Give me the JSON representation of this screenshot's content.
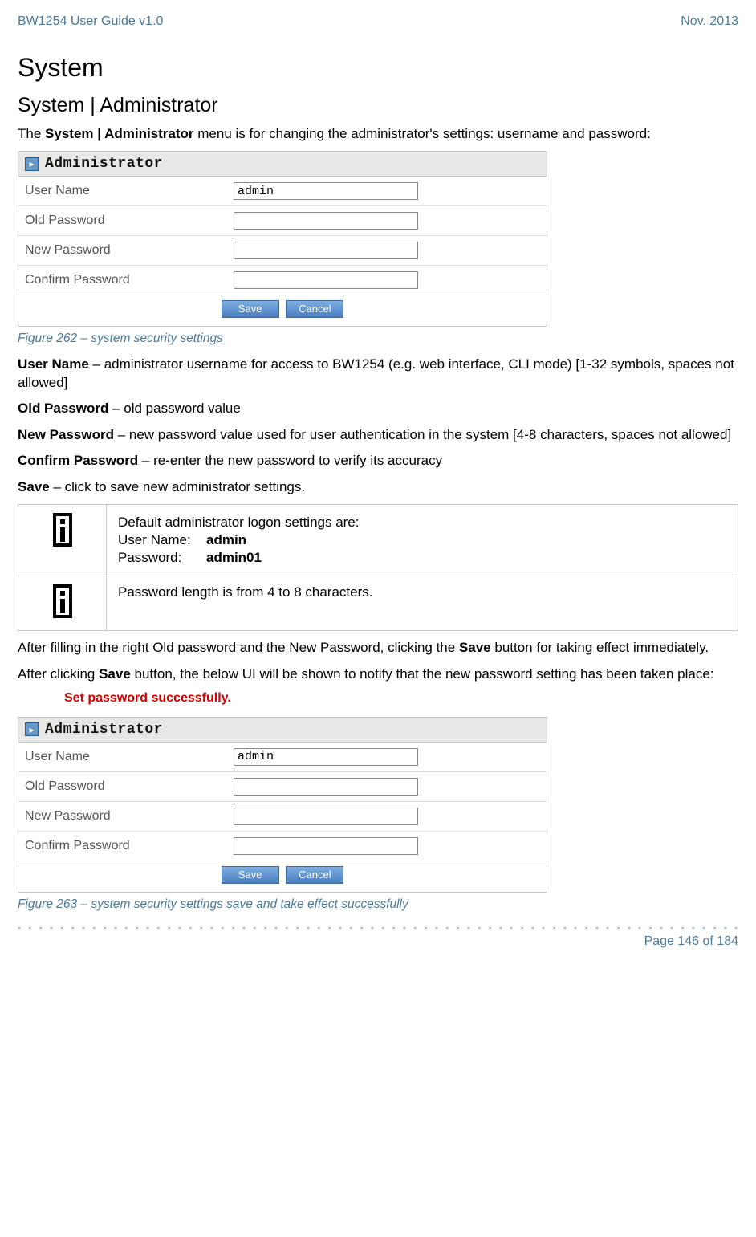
{
  "header": {
    "left": "BW1254 User Guide v1.0",
    "right": "Nov.  2013"
  },
  "h1": "System",
  "h2": "System | Administrator",
  "intro_pre": "The ",
  "intro_bold": "System | Administrator",
  "intro_post": " menu is for changing the administrator's settings: username and password:",
  "panel": {
    "title": "Administrator",
    "rows": {
      "username_label": "User Name",
      "username_value": "admin",
      "oldpw_label": "Old Password",
      "newpw_label": "New Password",
      "confirmpw_label": "Confirm Password"
    },
    "save": "Save",
    "cancel": "Cancel"
  },
  "fig1_caption": "Figure 262 – system security settings",
  "defs": {
    "username": {
      "term": "User Name",
      "text": " – administrator username for access to BW1254 (e.g. web interface, CLI mode) [1-32 symbols, spaces not allowed]"
    },
    "oldpw": {
      "term": "Old Password",
      "text": " – old password value"
    },
    "newpw": {
      "term": "New Password",
      "text": " – new password value used for user authentication in the system [4-8 characters, spaces not allowed]"
    },
    "confirmpw": {
      "term": "Confirm Password",
      "text": " – re-enter the new password to verify its accuracy"
    },
    "save": {
      "term": "Save",
      "text": " – click to save new administrator settings."
    }
  },
  "info1": {
    "line1": "Default administrator logon settings are:",
    "un_label": "User Name:",
    "un_value": "admin",
    "pw_label": "Password:",
    "pw_value": "admin01"
  },
  "info2": "Password length is from 4 to 8 characters.",
  "after1_pre": "After filling in the right Old password and the New Password, clicking the ",
  "after1_bold": "Save",
  "after1_post": " button for taking effect immediately.",
  "after2_pre": "After clicking ",
  "after2_bold": "Save",
  "after2_post": " button, the below UI will be shown to notify that the new password setting has been taken place:",
  "success": "Set password successfully.",
  "fig2_caption": "Figure 263 – system security settings save and take effect successfully",
  "footer": "Page 146 of 184"
}
